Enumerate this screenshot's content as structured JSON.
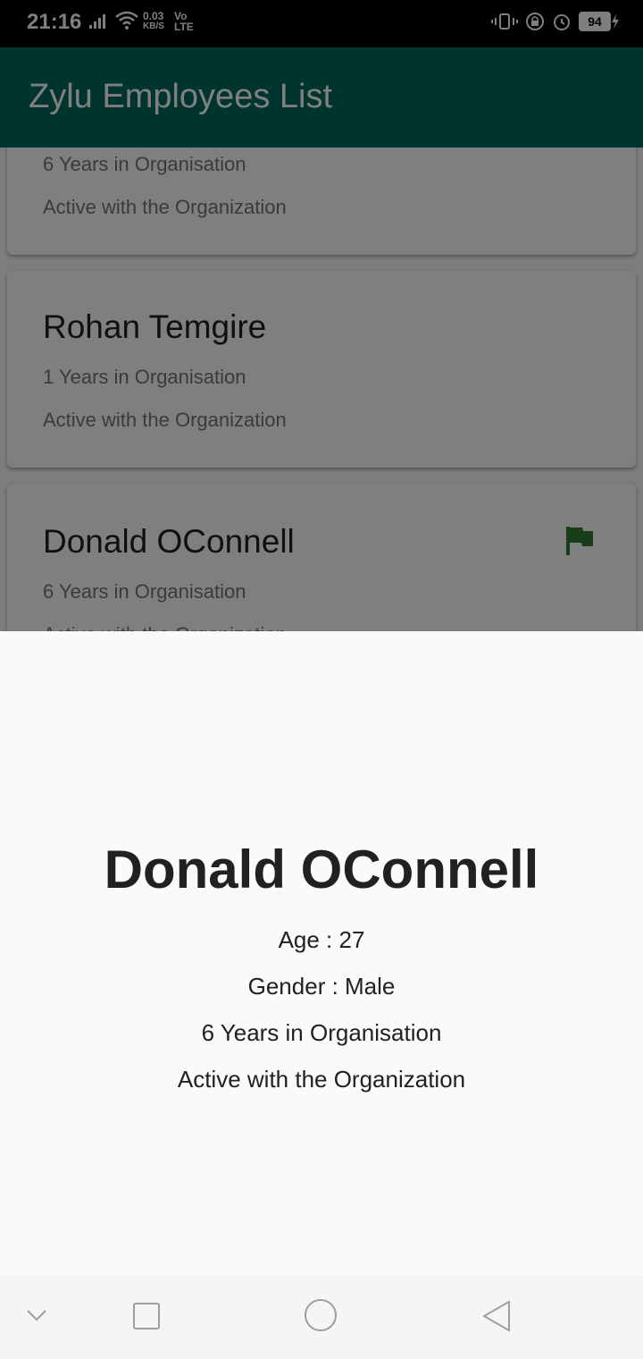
{
  "status_bar": {
    "time": "21:16",
    "net_speed_value": "0.03",
    "net_speed_unit": "KB/S",
    "volte_top": "Vo",
    "volte_bottom": "LTE",
    "battery": "94"
  },
  "app_bar": {
    "title": "Zylu Employees List",
    "color": "#00695c"
  },
  "list": {
    "cards": [
      {
        "name": "",
        "years": "6 Years in Organisation",
        "status": "Active with the Organization",
        "flag": false
      },
      {
        "name": "Rohan Temgire",
        "years": "1 Years in Organisation",
        "status": "Active with the Organization",
        "flag": false
      },
      {
        "name": "Donald OConnell",
        "years": "6 Years in Organisation",
        "status": "Active with the Organization",
        "flag": true
      }
    ],
    "flag_color": "#2e7d32"
  },
  "detail_sheet": {
    "name": "Donald OConnell",
    "age": "Age : 27",
    "gender": "Gender : Male",
    "years": "6 Years in Organisation",
    "status": "Active with the Organization"
  },
  "nav_bar": {
    "icons": [
      "chevron-down-icon",
      "square-icon",
      "circle-icon",
      "triangle-back-icon"
    ]
  }
}
